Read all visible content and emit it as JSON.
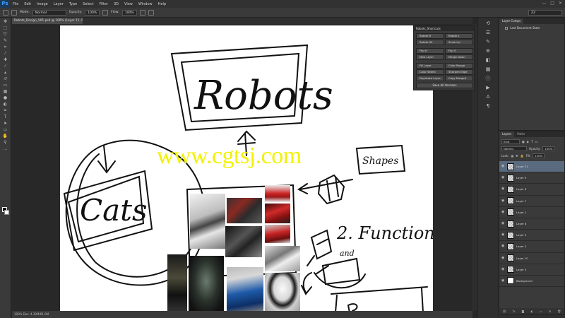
{
  "app": {
    "logo": "Ps",
    "menu": [
      "File",
      "Edit",
      "Image",
      "Layer",
      "Type",
      "Select",
      "Filter",
      "3D",
      "View",
      "Window",
      "Help"
    ],
    "window_controls": [
      "—",
      "□",
      "✕"
    ]
  },
  "options_bar": {
    "mode_label": "Mode:",
    "mode_value": "Normal",
    "opacity_label": "Opacity:",
    "opacity_value": "100%",
    "flow_label": "Flow:",
    "flow_value": "100%",
    "workspace": "ZZ"
  },
  "document": {
    "tab_title": "Robots_Design_V01.psd @ 100% (Layer 11, RGB/8)",
    "status_text": "100%      Doc: 4.39M/61.0M"
  },
  "watermark": "www.cgtsj.com",
  "sketch": {
    "robots": "Robots",
    "cats": "Cats",
    "shapes": "Shapes",
    "function": "2. Function",
    "form_and": "and"
  },
  "action_panel": {
    "title": "Robots_Shortcuts",
    "buttons": [
      "Rotate R",
      "Rotate L",
      "Rotate 90",
      "Scale Up",
      "Flip H",
      "Flip V",
      "New Layer",
      "Merge Down",
      "Fill Layer",
      "Color Range",
      "Color Select",
      "Sharpen Edge",
      "Duplicate Layer",
      "Copy Merged",
      "Save Version"
    ],
    "wide_button": "Save All Versions"
  },
  "layer_comps": {
    "tabs": [
      "Layer Comps"
    ],
    "row": "Last Document State"
  },
  "layers_panel": {
    "tabs": [
      "Layers",
      "Paths"
    ],
    "kind_label": "Kind",
    "blend_mode": "Normal",
    "opacity_label": "Opacity:",
    "opacity_value": "100%",
    "lock_label": "Lock:",
    "fill_label": "Fill:",
    "fill_value": "100%",
    "layers": [
      {
        "name": "Layer 11",
        "selected": true
      },
      {
        "name": "Layer 9",
        "selected": false
      },
      {
        "name": "Layer 6",
        "selected": false
      },
      {
        "name": "Layer 7",
        "selected": false
      },
      {
        "name": "Layer 1",
        "selected": false
      },
      {
        "name": "Layer 8",
        "selected": false
      },
      {
        "name": "Layer 5",
        "selected": false
      },
      {
        "name": "Layer 2",
        "selected": false
      },
      {
        "name": "Layer 10",
        "selected": false
      },
      {
        "name": "Layer 3",
        "selected": false
      },
      {
        "name": "Background",
        "selected": false,
        "white": true
      }
    ],
    "footer_icons": [
      "link-icon",
      "fx-icon",
      "mask-icon",
      "adjustment-icon",
      "folder-icon",
      "new-layer-icon",
      "trash-icon"
    ]
  }
}
